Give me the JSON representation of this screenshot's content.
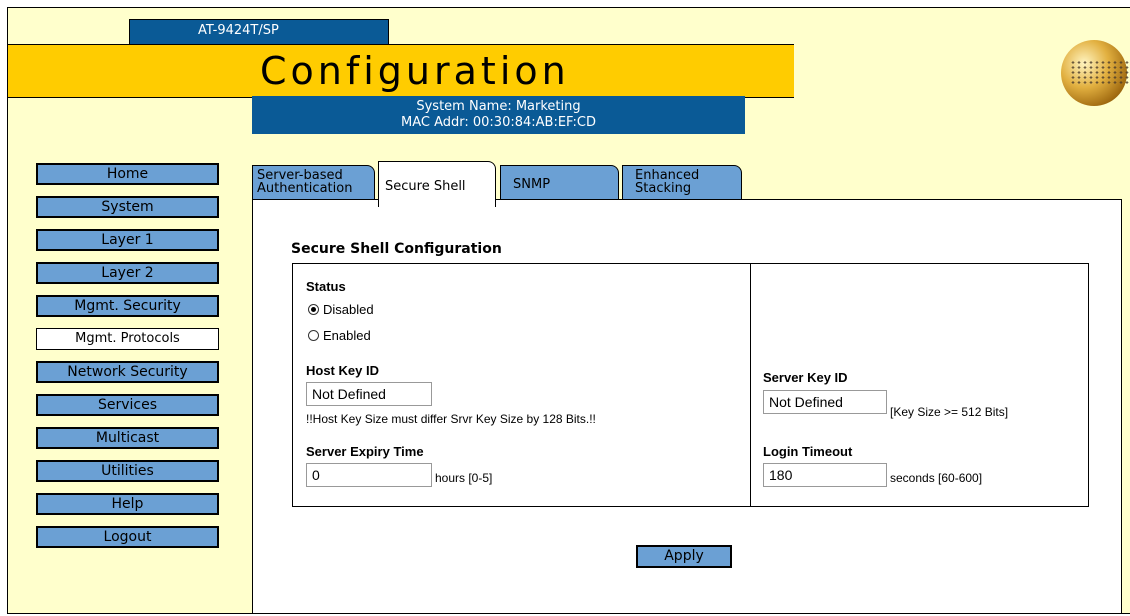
{
  "header": {
    "model": "AT-9424T/SP",
    "title": "Configuration",
    "system_name": "System Name: Marketing",
    "mac_addr": "MAC Addr: 00:30:84:AB:EF:CD",
    "logo_icon": "globe-logo-icon"
  },
  "nav": {
    "items": [
      {
        "label": "Home"
      },
      {
        "label": "System"
      },
      {
        "label": "Layer 1"
      },
      {
        "label": "Layer 2"
      },
      {
        "label": "Mgmt. Security"
      },
      {
        "label": "Mgmt. Protocols",
        "active": true
      },
      {
        "label": "Network Security"
      },
      {
        "label": "Services"
      },
      {
        "label": "Multicast"
      },
      {
        "label": "Utilities"
      },
      {
        "label": "Help"
      },
      {
        "label": "Logout"
      }
    ]
  },
  "tabs": [
    {
      "line1": "Server-based",
      "line2": "Authentication"
    },
    {
      "line1": "Secure Shell",
      "line2": "",
      "active": true
    },
    {
      "line1": "SNMP",
      "line2": ""
    },
    {
      "line1": "Enhanced",
      "line2": "Stacking"
    }
  ],
  "form": {
    "section_title": "Secure Shell Configuration",
    "status_label": "Status",
    "status_options": [
      "Disabled",
      "Enabled"
    ],
    "status_selected": "Disabled",
    "host_key_label": "Host Key ID",
    "host_key_value": "Not Defined",
    "host_key_note": "!!Host Key Size must differ Srvr Key Size by 128 Bits.!!",
    "expiry_label": "Server Expiry Time",
    "expiry_value": "0",
    "expiry_unit": "hours [0-5]",
    "server_key_label": "Server Key ID",
    "server_key_value": "Not Defined",
    "server_key_note": "[Key Size >= 512 Bits]",
    "login_timeout_label": "Login Timeout",
    "login_timeout_value": "180",
    "login_timeout_unit": "seconds [60-600]",
    "apply_label": "Apply"
  },
  "colors": {
    "banner": "#ffcc00",
    "navy": "#0a5a96",
    "button": "#6ba0d4",
    "background": "#ffffcc"
  }
}
